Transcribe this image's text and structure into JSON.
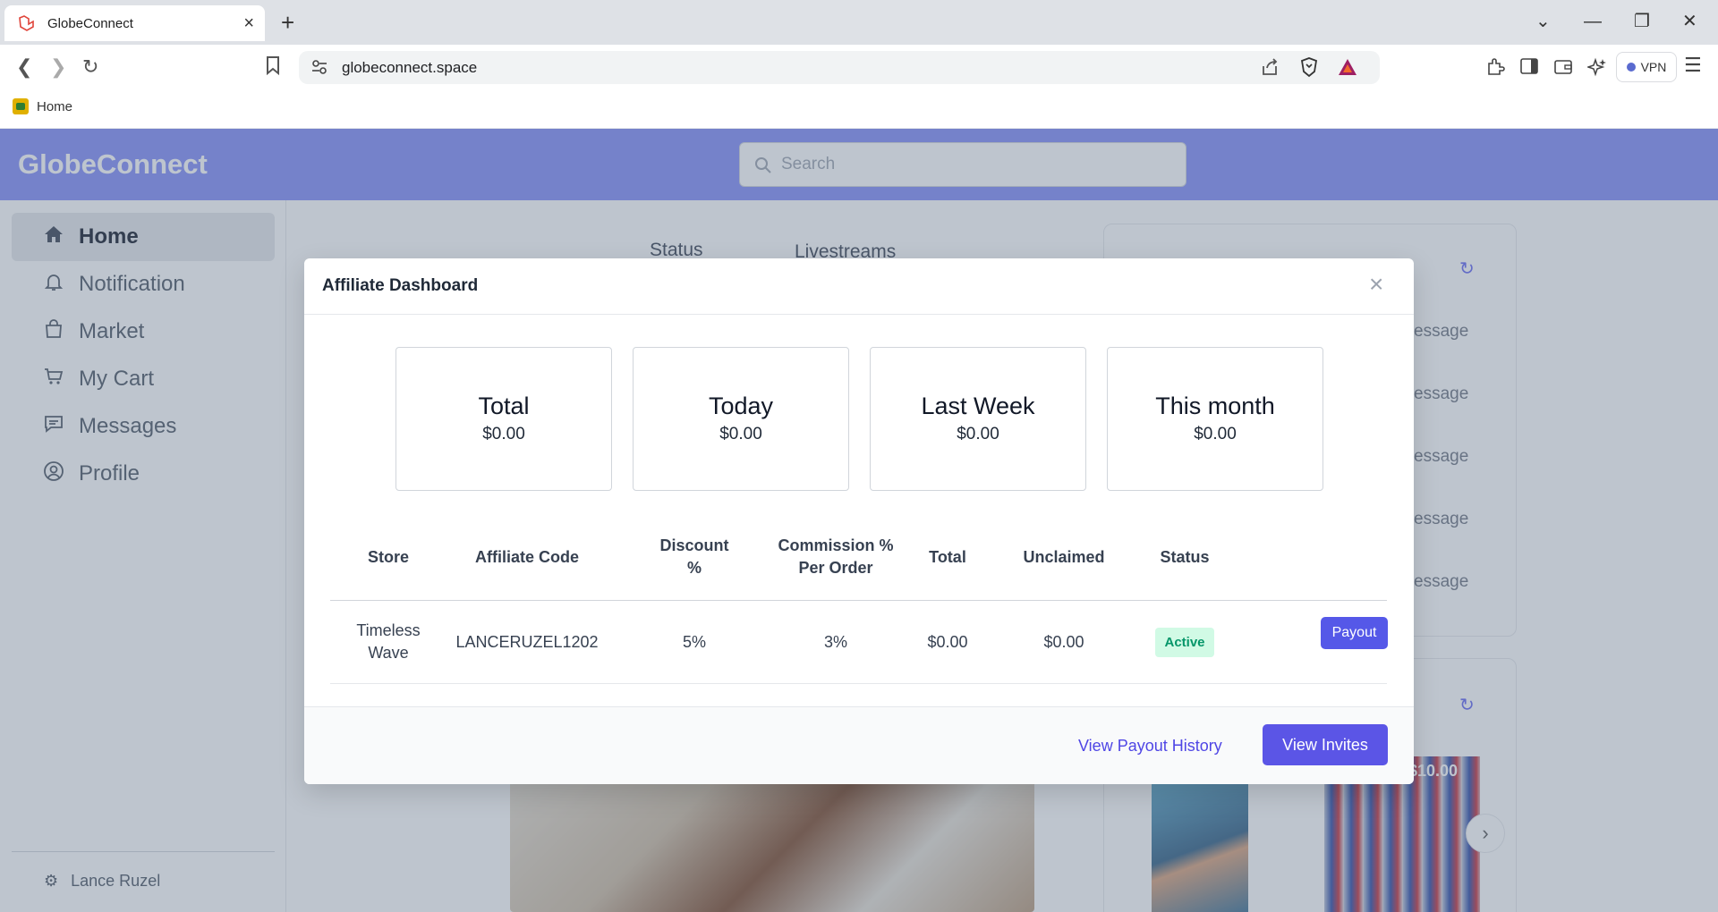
{
  "browser": {
    "tab_title": "GlobeConnect",
    "url": "globeconnect.space",
    "bookmark_label": "Home",
    "vpn_label": "VPN"
  },
  "app": {
    "brand": "GlobeConnect",
    "search_placeholder": "Search",
    "sidebar": {
      "items": [
        {
          "label": "Home",
          "icon": "home-icon"
        },
        {
          "label": "Notification",
          "icon": "bell-icon"
        },
        {
          "label": "Market",
          "icon": "bag-icon"
        },
        {
          "label": "My Cart",
          "icon": "cart-icon"
        },
        {
          "label": "Messages",
          "icon": "message-icon"
        },
        {
          "label": "Profile",
          "icon": "user-icon"
        }
      ],
      "user_name": "Lance Ruzel"
    },
    "feed_tabs": [
      "Status",
      "Livestreams"
    ],
    "message_snippets": [
      "essage",
      "essage",
      "essage",
      "essage",
      "essage"
    ],
    "product_price": "$10.00"
  },
  "modal": {
    "title": "Affiliate Dashboard",
    "stats": [
      {
        "label": "Total",
        "value": "$0.00"
      },
      {
        "label": "Today",
        "value": "$0.00"
      },
      {
        "label": "Last Week",
        "value": "$0.00"
      },
      {
        "label": "This month",
        "value": "$0.00"
      }
    ],
    "table": {
      "headers": [
        "Store",
        "Affiliate Code",
        "Discount %",
        "Commission % Per Order",
        "Total",
        "Unclaimed",
        "Status"
      ],
      "rows": [
        {
          "store": "Timeless Wave",
          "code": "LANCERUZEL1202",
          "discount": "5%",
          "commission": "3%",
          "total": "$0.00",
          "unclaimed": "$0.00",
          "status": "Active",
          "action": "Payout"
        }
      ]
    },
    "footer": {
      "history_link": "View Payout History",
      "invites_button": "View Invites"
    }
  }
}
